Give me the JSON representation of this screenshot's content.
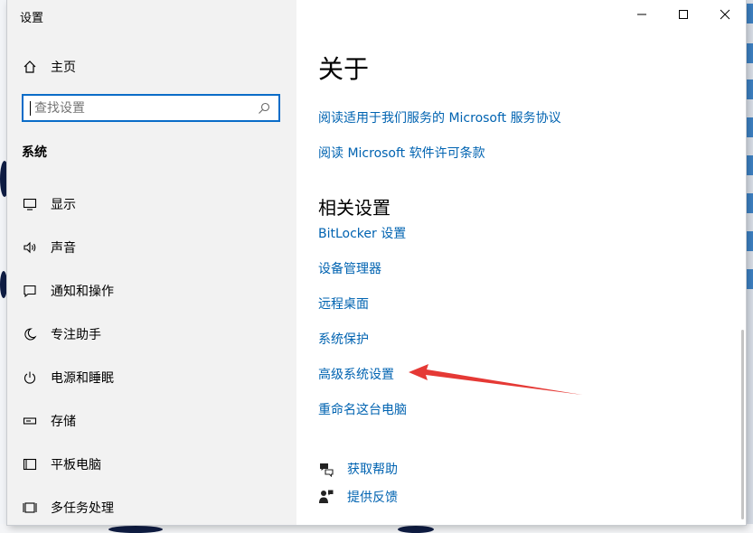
{
  "window": {
    "title": "设置"
  },
  "sidebar": {
    "home_label": "主页",
    "search": {
      "placeholder": "查找设置",
      "value": ""
    },
    "section_label": "系统",
    "items": [
      {
        "label": "显示",
        "icon": "monitor-icon"
      },
      {
        "label": "声音",
        "icon": "speaker-icon"
      },
      {
        "label": "通知和操作",
        "icon": "notification-icon"
      },
      {
        "label": "专注助手",
        "icon": "moon-icon"
      },
      {
        "label": "电源和睡眠",
        "icon": "power-icon"
      },
      {
        "label": "存储",
        "icon": "storage-icon"
      },
      {
        "label": "平板电脑",
        "icon": "tablet-icon"
      },
      {
        "label": "多任务处理",
        "icon": "multitask-icon"
      }
    ]
  },
  "main": {
    "title": "关于",
    "links": [
      "阅读适用于我们服务的 Microsoft 服务协议",
      "阅读 Microsoft 软件许可条款"
    ],
    "related_heading": "相关设置",
    "related_links": [
      "BitLocker 设置",
      "设备管理器",
      "远程桌面",
      "系统保护",
      "高级系统设置",
      "重命名这台电脑"
    ],
    "help_links": [
      {
        "label": "获取帮助",
        "icon": "help-chat-icon"
      },
      {
        "label": "提供反馈",
        "icon": "feedback-icon"
      }
    ]
  },
  "colors": {
    "accent": "#0063b1",
    "search_border": "#0a6cc8",
    "arrow": "#e53935",
    "sidebar_bg": "#f2f2f2"
  }
}
